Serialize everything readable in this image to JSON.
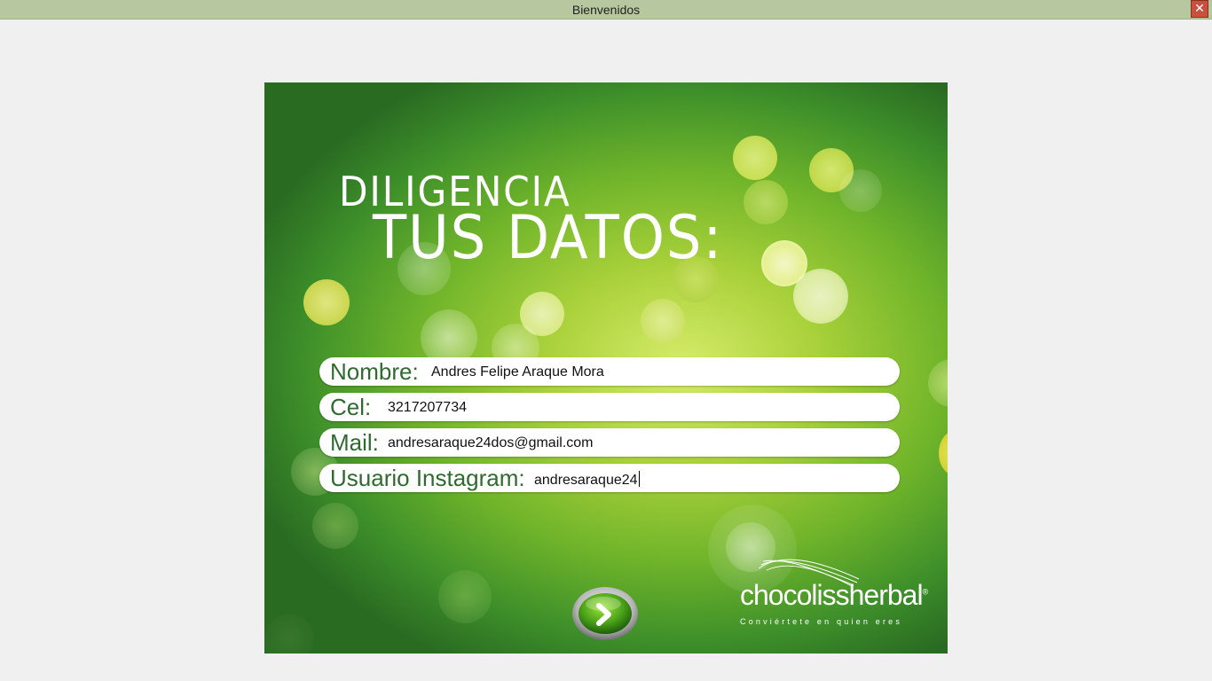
{
  "window": {
    "title": "Bienvenidos",
    "close_label": "✕"
  },
  "heading": {
    "line1": "DILIGENCIA",
    "line2": "TUS DATOS:"
  },
  "form": {
    "nombre": {
      "label": "Nombre:",
      "value": "Andres Felipe Araque Mora"
    },
    "cel": {
      "label": "Cel:",
      "value": "3217207734"
    },
    "mail": {
      "label": "Mail:",
      "value": "andresaraque24dos@gmail.com"
    },
    "instagram": {
      "label": "Usuario Instagram:",
      "value": "andresaraque24"
    }
  },
  "next_button": {
    "icon": "chevron-right-icon"
  },
  "logo": {
    "brand": "chocolissherbal",
    "registered": "®",
    "tagline": "Conviértete en quien eres"
  },
  "colors": {
    "titlebar": "#b7c7a0",
    "close": "#c7503f",
    "label_green": "#2f6b2f",
    "panel_green": "#6fb42a"
  }
}
